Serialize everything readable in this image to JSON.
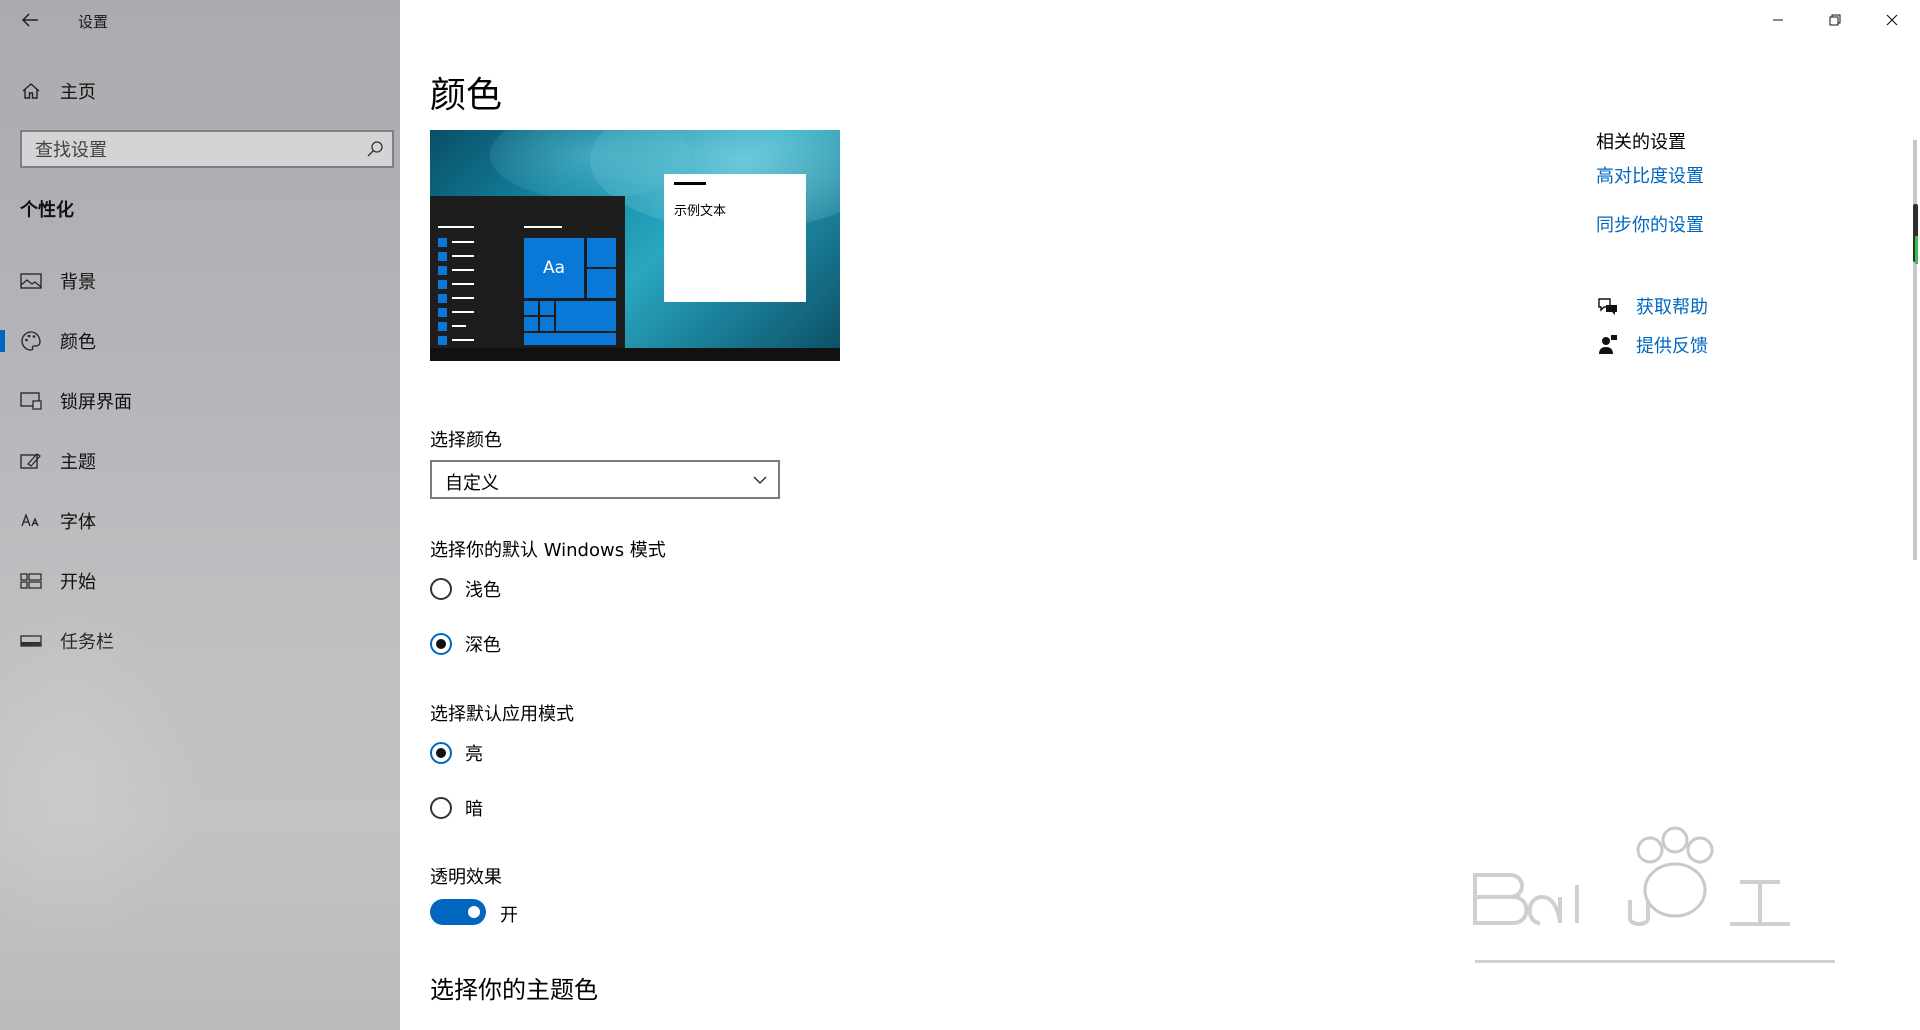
{
  "app": {
    "title": "设置"
  },
  "sidebar": {
    "home_label": "主页",
    "search_placeholder": "查找设置",
    "section_title": "个性化",
    "items": [
      {
        "label": "背景",
        "icon": "image-icon"
      },
      {
        "label": "颜色",
        "icon": "palette-icon",
        "active": true
      },
      {
        "label": "锁屏界面",
        "icon": "lock-screen-icon"
      },
      {
        "label": "主题",
        "icon": "theme-icon"
      },
      {
        "label": "字体",
        "icon": "font-icon"
      },
      {
        "label": "开始",
        "icon": "start-icon"
      },
      {
        "label": "任务栏",
        "icon": "taskbar-icon"
      }
    ]
  },
  "main": {
    "title": "颜色",
    "preview": {
      "sample_text": "示例文本",
      "tile_text": "Aa"
    },
    "choose_color": {
      "label": "选择颜色",
      "value": "自定义"
    },
    "windows_mode": {
      "label": "选择你的默认 Windows 模式",
      "options": [
        {
          "label": "浅色",
          "selected": false
        },
        {
          "label": "深色",
          "selected": true
        }
      ]
    },
    "app_mode": {
      "label": "选择默认应用模式",
      "options": [
        {
          "label": "亮",
          "selected": true
        },
        {
          "label": "暗",
          "selected": false
        }
      ]
    },
    "transparency": {
      "label": "透明效果",
      "state": "开",
      "on": true
    },
    "accent_heading": "选择你的主题色"
  },
  "related": {
    "title": "相关的设置",
    "links": [
      "高对比度设置",
      "同步你的设置"
    ],
    "help": "获取帮助",
    "feedback": "提供反馈"
  },
  "colors": {
    "accent": "#0067c0",
    "tile_blue": "#0a78d7"
  }
}
